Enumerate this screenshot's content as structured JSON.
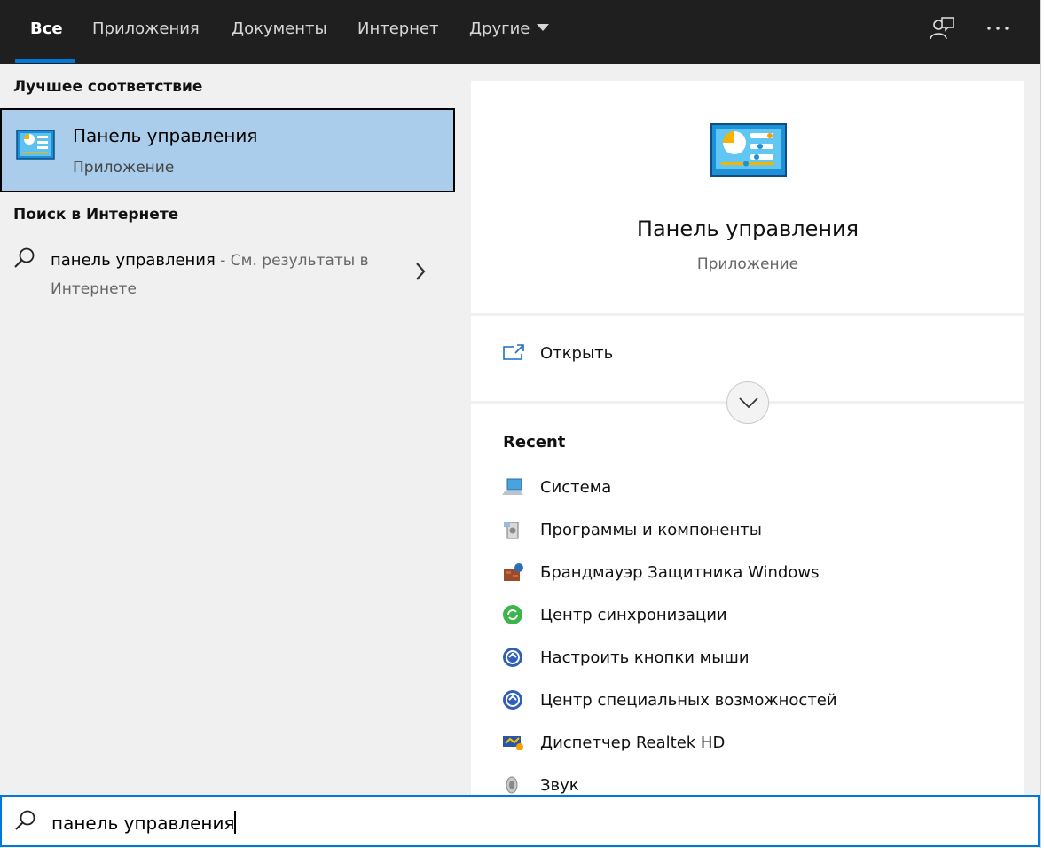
{
  "tabs": [
    {
      "label": "Все",
      "active": true
    },
    {
      "label": "Приложения"
    },
    {
      "label": "Документы"
    },
    {
      "label": "Интернет"
    },
    {
      "label": "Другие"
    }
  ],
  "topbar_icons": [
    "feedback-icon",
    "more-icon"
  ],
  "best_match": {
    "header": "Лучшее соответствие",
    "title": "Панель управления",
    "subtitle": "Приложение",
    "icon": "control-panel-icon"
  },
  "web_search": {
    "header": "Поиск в Интернете",
    "query": "панель управления",
    "suffix": " - См. результаты в Интернете"
  },
  "preview": {
    "title": "Панель управления",
    "subtitle": "Приложение",
    "open_label": "Открыть",
    "recent_header": "Recent",
    "recent_items": [
      {
        "label": "Система",
        "icon": "system-icon"
      },
      {
        "label": "Программы и компоненты",
        "icon": "programs-icon"
      },
      {
        "label": "Брандмауэр Защитника Windows",
        "icon": "firewall-icon"
      },
      {
        "label": "Центр синхронизации",
        "icon": "sync-center-icon"
      },
      {
        "label": "Настроить кнопки мыши",
        "icon": "ease-of-access-icon"
      },
      {
        "label": "Центр специальных возможностей",
        "icon": "ease-of-access-icon"
      },
      {
        "label": "Диспетчер Realtek HD",
        "icon": "realtek-icon"
      },
      {
        "label": "Звук",
        "icon": "sound-icon"
      }
    ]
  },
  "search": {
    "value": "панель управления"
  },
  "colors": {
    "accent": "#0078d7",
    "selected": "#a9cdea",
    "topbar": "#1f1f1f"
  }
}
